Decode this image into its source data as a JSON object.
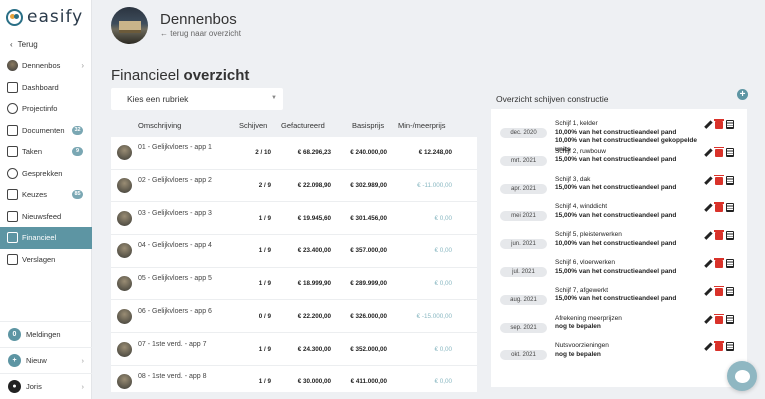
{
  "brand": {
    "name": "easify"
  },
  "sidebar": {
    "back_label": "Terug",
    "items": [
      {
        "label": "Dennenbos",
        "icon": "project-avatar",
        "chevron": "›",
        "badge": ""
      },
      {
        "label": "Dashboard",
        "icon": "dashboard-icon",
        "chevron": "",
        "badge": ""
      },
      {
        "label": "Projectinfo",
        "icon": "info-icon",
        "chevron": "",
        "badge": ""
      },
      {
        "label": "Documenten",
        "icon": "documents-icon",
        "chevron": "",
        "badge": "32"
      },
      {
        "label": "Taken",
        "icon": "tasks-icon",
        "chevron": "",
        "badge": "9"
      },
      {
        "label": "Gesprekken",
        "icon": "chat-icon",
        "chevron": "",
        "badge": ""
      },
      {
        "label": "Keuzes",
        "icon": "choices-icon",
        "chevron": "",
        "badge": "85"
      },
      {
        "label": "Nieuwsfeed",
        "icon": "news-icon",
        "chevron": "",
        "badge": ""
      },
      {
        "label": "Financieel",
        "icon": "finance-icon",
        "chevron": "",
        "badge": "",
        "active": true
      },
      {
        "label": "Verslagen",
        "icon": "reports-icon",
        "chevron": "",
        "badge": ""
      }
    ],
    "bottom": {
      "notifications_count": "0",
      "notifications_label": "Meldingen",
      "new_label": "Nieuw",
      "new_symbol": "+",
      "user_label": "Joris"
    }
  },
  "header": {
    "project_title": "Dennenbos",
    "back_link": "← terug naar overzicht"
  },
  "page": {
    "title_regular": "Financieel ",
    "title_bold": "overzicht",
    "rubric_placeholder": "Kies een rubriek"
  },
  "table": {
    "columns": [
      "Omschrijving",
      "Schijven",
      "Gefactureerd",
      "Basisprijs",
      "Min-/meerprijs"
    ],
    "rows": [
      {
        "name": "01 - Gelijkvloers - app 1",
        "schijven": "2 / 10",
        "gefactureerd": "€ 68.296,23",
        "basisprijs": "€ 240.000,00",
        "diff": "€ 12.248,00",
        "diff_bold": true
      },
      {
        "name": "02 - Gelijkvloers - app 2",
        "schijven": "2 / 9",
        "gefactureerd": "€ 22.098,90",
        "basisprijs": "€ 302.989,00",
        "diff": "€ -11.000,00",
        "diff_bold": false
      },
      {
        "name": "03 - Gelijkvloers - app 3",
        "schijven": "1 / 9",
        "gefactureerd": "€ 19.945,60",
        "basisprijs": "€ 301.456,00",
        "diff": "€ 0,00",
        "diff_bold": false
      },
      {
        "name": "04 - Gelijkvloers - app 4",
        "schijven": "1 / 9",
        "gefactureerd": "€ 23.400,00",
        "basisprijs": "€ 357.000,00",
        "diff": "€ 0,00",
        "diff_bold": false
      },
      {
        "name": "05 - Gelijkvloers - app 5",
        "schijven": "1 / 9",
        "gefactureerd": "€ 18.999,90",
        "basisprijs": "€ 289.999,00",
        "diff": "€ 0,00",
        "diff_bold": false
      },
      {
        "name": "06 - Gelijkvloers - app 6",
        "schijven": "0 / 9",
        "gefactureerd": "€ 22.200,00",
        "basisprijs": "€ 326.000,00",
        "diff": "€ -15.000,00",
        "diff_bold": false
      },
      {
        "name": "07 - 1ste verd. - app 7",
        "schijven": "1 / 9",
        "gefactureerd": "€ 24.300,00",
        "basisprijs": "€ 352.000,00",
        "diff": "€ 0,00",
        "diff_bold": false
      },
      {
        "name": "08 - 1ste verd. - app 8",
        "schijven": "1 / 9",
        "gefactureerd": "€ 30.000,00",
        "basisprijs": "€ 411.000,00",
        "diff": "€ 0,00",
        "diff_bold": false
      }
    ]
  },
  "schedule": {
    "title": "Overzicht schijven constructie",
    "add_symbol": "+",
    "items": [
      {
        "date": "dec. 2020",
        "title": "Schijf 1, kelder",
        "lines": [
          "10,00% van het constructieandeel pand",
          "10,00% van het constructieandeel gekoppelde units"
        ]
      },
      {
        "date": "mrt. 2021",
        "title": "Schijf 2, ruwbouw",
        "lines": [
          "15,00% van het constructieandeel pand"
        ]
      },
      {
        "date": "apr. 2021",
        "title": "Schijf 3, dak",
        "lines": [
          "15,00% van het constructieandeel pand"
        ]
      },
      {
        "date": "mei 2021",
        "title": "Schijf 4, winddicht",
        "lines": [
          "15,00% van het constructieandeel pand"
        ]
      },
      {
        "date": "jun. 2021",
        "title": "Schijf 5, pleisterwerken",
        "lines": [
          "10,00% van het constructieandeel pand"
        ]
      },
      {
        "date": "jul. 2021",
        "title": "Schijf 6, vloerwerken",
        "lines": [
          "15,00% van het constructieandeel pand"
        ]
      },
      {
        "date": "aug. 2021",
        "title": "Schijf 7, afgewerkt",
        "lines": [
          "15,00% van het constructieandeel pand"
        ]
      },
      {
        "date": "sep. 2021",
        "title": "Afrekening meerprijzen",
        "lines": [
          "nog te bepalen"
        ]
      },
      {
        "date": "okt. 2021",
        "title": "Nutsvoorzieningen",
        "lines": [
          "nog te bepalen"
        ]
      }
    ]
  },
  "colors": {
    "accent": "#5d95a3",
    "danger": "#d9322a",
    "diff_negative": "#8ab8c2"
  }
}
